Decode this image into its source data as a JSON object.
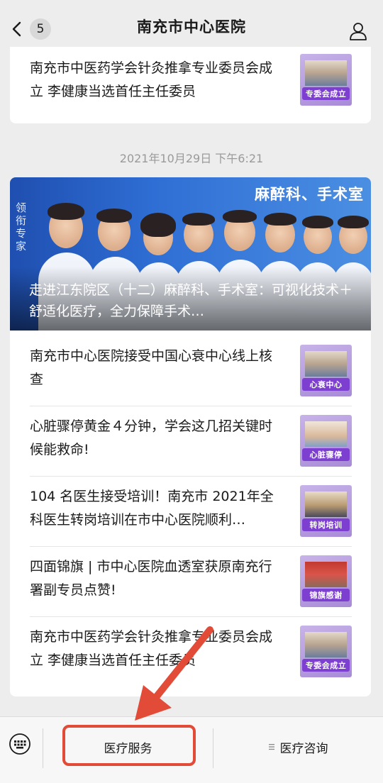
{
  "nav": {
    "back_badge": "5",
    "title": "南充市中心医院"
  },
  "top_article": {
    "title": "南充市中医药学会针灸推拿专业委员会成立 李健康当选首任主任委员",
    "thumb_caption": "专委会成立"
  },
  "timestamp": "2021年10月29日 下午6:21",
  "banner": {
    "tag": "麻醉科、手术室",
    "side_text": "领衔专家",
    "caption": "走进江东院区（十二）麻醉科、手术室：可视化技术＋舒适化医疗，全力保障手术…"
  },
  "articles": [
    {
      "title": "南充市中心医院接受中国心衰中心线上核查",
      "thumb_caption": "心衰中心"
    },
    {
      "title": "心脏骤停黄金４分钟，学会这几招关键时候能救命!",
      "thumb_caption": "心脏骤停"
    },
    {
      "title": "104 名医生接受培训！南充市 2021年全科医生转岗培训在市中心医院顺利…",
      "thumb_caption": "转岗培训"
    },
    {
      "title": "四面锦旗 | 市中心医院血透室获原南充行署副专员点赞!",
      "thumb_caption": "锦旗感谢"
    },
    {
      "title": "南充市中医药学会针灸推拿专业委员会成立 李健康当选首任主任委员",
      "thumb_caption": "专委会成立"
    }
  ],
  "bottom_menu": {
    "item1": "医疗服务",
    "item2": "医疗咨询"
  },
  "colors": {
    "accent_purple": "#7d3fd0",
    "highlight_red": "#e24b37"
  }
}
